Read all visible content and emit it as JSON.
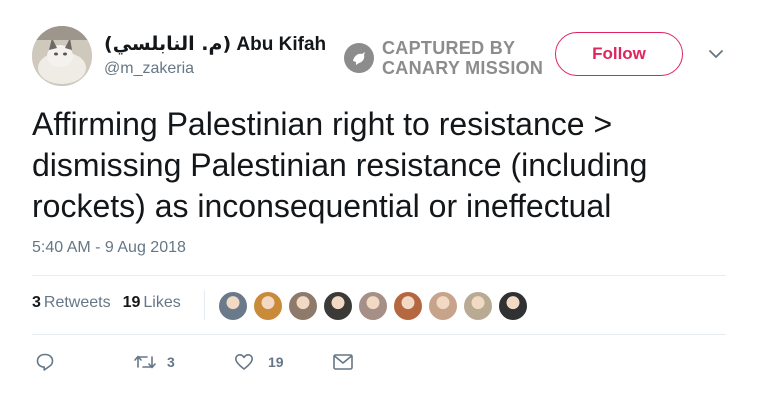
{
  "user": {
    "display_name": "Abu Kifah",
    "display_name_arabic": "(م. النابلسي)",
    "handle": "@m_zakeria"
  },
  "watermark": {
    "line1": "CAPTURED BY",
    "line2": "CANARY MISSION",
    "icon": "canary-bird-icon"
  },
  "follow_label": "Follow",
  "tweet": {
    "lines": [
      "Affirming Palestinian right to resistance >",
      "dismissing Palestinian resistance (including",
      "rockets) as inconsequential or ineffectual"
    ],
    "timestamp": "5:40 AM - 9 Aug 2018"
  },
  "stats": {
    "retweets_count": "3",
    "retweets_label": "Retweets",
    "likes_count": "19",
    "likes_label": "Likes"
  },
  "likers": [
    {
      "name": "liker-1",
      "color": "#6b7a8a"
    },
    {
      "name": "liker-2",
      "color": "#c98a3a"
    },
    {
      "name": "liker-3",
      "color": "#8d7a6a"
    },
    {
      "name": "liker-4",
      "color": "#3c3a36"
    },
    {
      "name": "liker-5",
      "color": "#a58f86"
    },
    {
      "name": "liker-6",
      "color": "#b5673f"
    },
    {
      "name": "liker-7",
      "color": "#c7a38b"
    },
    {
      "name": "liker-8",
      "color": "#b9aa94"
    },
    {
      "name": "liker-9",
      "color": "#2f3133"
    }
  ],
  "actions": {
    "reply_icon": "reply-icon",
    "retweet_icon": "retweet-icon",
    "retweet_count": "3",
    "like_icon": "heart-icon",
    "like_count": "19",
    "dm_icon": "envelope-icon"
  },
  "colors": {
    "accent": "#e0245e",
    "muted": "#657786",
    "divider": "#e6ecf0",
    "text": "#14171a"
  }
}
